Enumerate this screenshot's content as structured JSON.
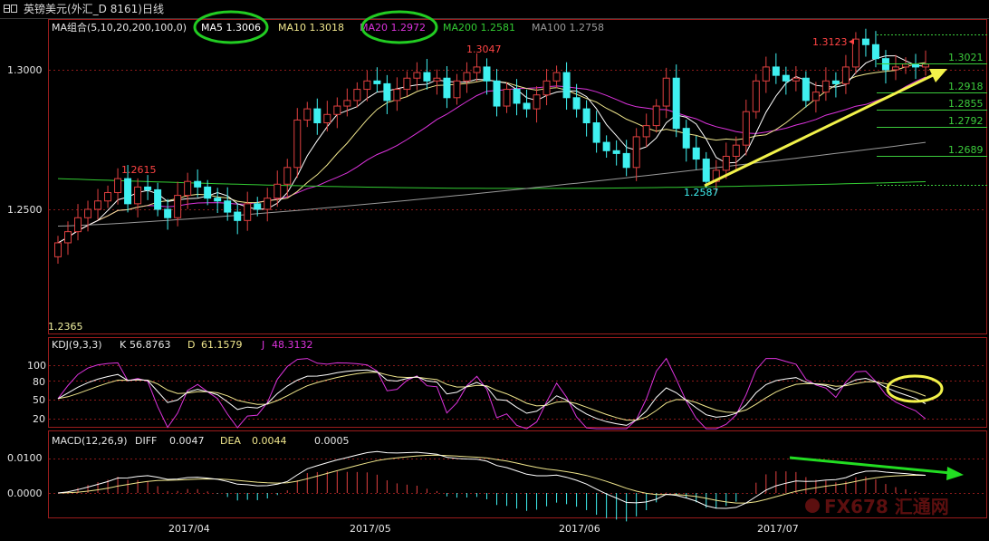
{
  "window": {
    "title": "英镑美元(外汇_D 8161)日线",
    "icon": "window-icon"
  },
  "colors": {
    "up": "#e04040",
    "down": "#3ff0f0",
    "ma5": "#ffffff",
    "ma10": "#f0e68c",
    "ma20": "#dd33dd",
    "ma200": "#33cc33",
    "ma100": "#9a9a9a",
    "grid": "#8b1a1a",
    "macd_up": "#e04040",
    "macd_down": "#3ff0f0"
  },
  "header": {
    "ma_label": "MA组合(5,10,20,200,100,0)",
    "ma5": "MA5 1.3006",
    "ma10": "MA10 1.3018",
    "ma20": "MA20 1.2972",
    "ma200": "MA200 1.2581",
    "ma100": "MA100 1.2758"
  },
  "kdj_header": {
    "name": "KDJ(9,3,3)",
    "k_label": "K",
    "k": "56.8763",
    "d_label": "D",
    "d": "61.1579",
    "j_label": "J",
    "j": "48.3132"
  },
  "macd_header": {
    "name": "MACD(12,26,9)",
    "diff_label": "DIFF",
    "diff": "0.0047",
    "dea_label": "DEA",
    "dea": "0.0044",
    "macd": "0.0005"
  },
  "annotations": {
    "hi1": "1.2615",
    "hi2": "1.3047",
    "hi3": "1.3123",
    "lo1": "1.2587",
    "lo0": "1.2365",
    "fib": [
      "1.3021",
      "1.2918",
      "1.2855",
      "1.2792",
      "1.2689"
    ]
  },
  "watermark": "FX678 汇通网",
  "chart_data": [
    {
      "type": "candlestick",
      "title": "英镑美元(外汇_D 8161)日线",
      "x": [
        "2017/04",
        "2017/05",
        "2017/06",
        "2017/07"
      ],
      "y_ticks": [
        "1.3000",
        "1.2500"
      ],
      "ylim": [
        1.2365,
        1.3123
      ],
      "series": [
        {
          "name": "MA5",
          "last": 1.3006
        },
        {
          "name": "MA10",
          "last": 1.3018
        },
        {
          "name": "MA20",
          "last": 1.2972
        },
        {
          "name": "MA200",
          "last": 1.2581
        },
        {
          "name": "MA100",
          "last": 1.2758
        }
      ],
      "close": [
        1.238,
        1.242,
        1.247,
        1.25,
        1.253,
        1.256,
        1.261,
        1.252,
        1.258,
        1.257,
        1.25,
        1.247,
        1.255,
        1.26,
        1.258,
        1.254,
        1.253,
        1.249,
        1.246,
        1.252,
        1.25,
        1.254,
        1.259,
        1.265,
        1.282,
        1.286,
        1.281,
        1.284,
        1.287,
        1.289,
        1.293,
        1.296,
        1.295,
        1.289,
        1.293,
        1.297,
        1.299,
        1.296,
        1.297,
        1.29,
        1.296,
        1.299,
        1.301,
        1.296,
        1.287,
        1.293,
        1.288,
        1.286,
        1.291,
        1.296,
        1.299,
        1.29,
        1.286,
        1.281,
        1.274,
        1.271,
        1.27,
        1.265,
        1.276,
        1.28,
        1.287,
        1.297,
        1.279,
        1.272,
        1.268,
        1.26,
        1.264,
        1.269,
        1.273,
        1.285,
        1.296,
        1.301,
        1.298,
        1.296,
        1.297,
        1.289,
        1.292,
        1.296,
        1.295,
        1.301,
        1.311,
        1.309,
        1.304,
        1.3,
        1.301,
        1.302,
        1.301,
        1.302
      ],
      "annotations": {
        "high_labels": [
          1.2615,
          1.3047,
          1.3123
        ],
        "low_labels": [
          1.2587,
          1.2365
        ]
      },
      "fib_levels": [
        1.3021,
        1.2918,
        1.2855,
        1.2792,
        1.2689
      ]
    },
    {
      "type": "line",
      "title": "KDJ(9,3,3)",
      "y_ticks": [
        100,
        80,
        50,
        20
      ],
      "ylim": [
        0,
        110
      ],
      "series": [
        {
          "name": "K",
          "last": 56.8763
        },
        {
          "name": "D",
          "last": 61.1579
        },
        {
          "name": "J",
          "last": 48.3132
        }
      ]
    },
    {
      "type": "bar",
      "title": "MACD(12,26,9)",
      "y_ticks": [
        "0.0100",
        "0.0000"
      ],
      "series": [
        {
          "name": "DIFF",
          "last": 0.0047
        },
        {
          "name": "DEA",
          "last": 0.0044
        },
        {
          "name": "MACD",
          "last": 0.0005
        }
      ]
    }
  ]
}
